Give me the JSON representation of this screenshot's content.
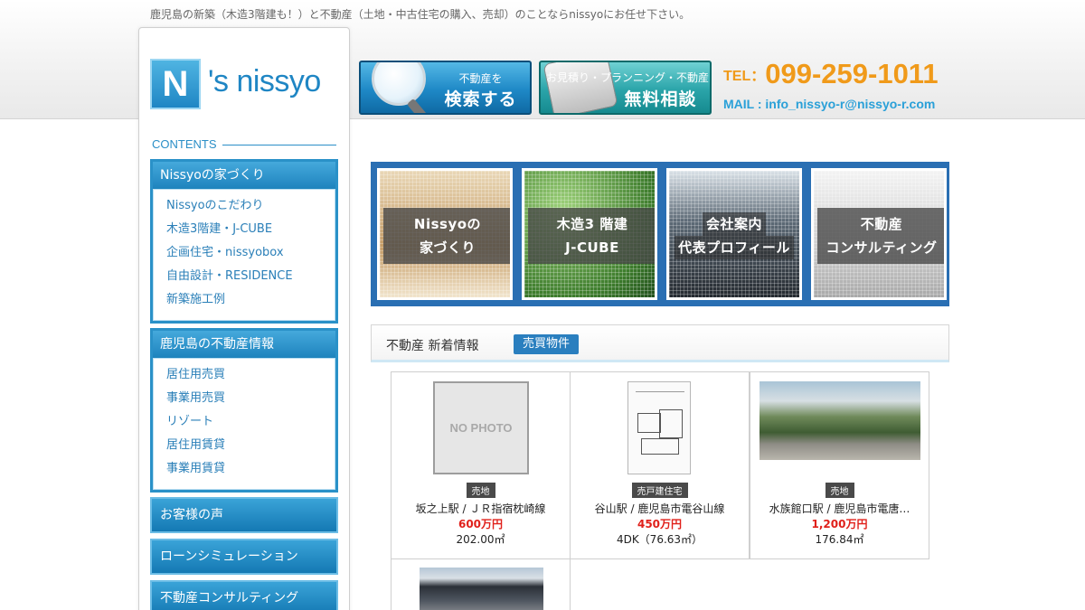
{
  "header": {
    "tagline": "鹿児島の新築（木造3階建も！）と不動産（土地・中古住宅の購入、売却）のことならnissyoにお任せ下さい。",
    "search_button": {
      "small": "不動産を",
      "big": "検索する"
    },
    "consult_button": {
      "small": "お見積り・プランニング・不動産の",
      "big": "無料相談"
    },
    "tel_label": "TEL：",
    "tel_number": "099-259-1011",
    "mail": "MAIL : info_nissyo-r@nissyo-r.com"
  },
  "logo": {
    "mark": "N",
    "text": "'s nissyo"
  },
  "sidebar": {
    "contents_heading": "CONTENTS",
    "sections": [
      {
        "title": "Nissyoの家づくり",
        "items": [
          "Nissyoのこだわり",
          "木造3階建・J-CUBE",
          "企画住宅・nissyobox",
          "自由設計・RESIDENCE",
          "新築施工例"
        ]
      },
      {
        "title": "鹿児島の不動産情報",
        "items": [
          "居住用売買",
          "事業用売買",
          "リゾート",
          "居住用賃貸",
          "事業用賃貸"
        ]
      }
    ],
    "buttons": [
      "お客様の声",
      "ローンシミュレーション",
      "不動産コンサルティング"
    ]
  },
  "banners": [
    {
      "line1": "Nissyoの",
      "line2": "家づくり"
    },
    {
      "line1": "木造3 階建",
      "line2": "J-CUBE"
    },
    {
      "line1": "会社案内",
      "line2": "代表プロフィール"
    },
    {
      "line1": "不動産",
      "line2": "コンサルティング"
    }
  ],
  "news": {
    "title": "不動産 新着情報",
    "tab": "売買物件",
    "listings": [
      {
        "thumb_text": "NO PHOTO",
        "type": "売地",
        "location": "坂之上駅 / ＪＲ指宿枕崎線",
        "price": "600万円",
        "size": "202.00㎡"
      },
      {
        "thumb_text": "",
        "type": "売戸建住宅",
        "location": "谷山駅 / 鹿児島市電谷山線",
        "price": "450万円",
        "size": "4DK（76.63㎡）"
      },
      {
        "thumb_text": "",
        "type": "売地",
        "location": "水族館口駅 / 鹿児島市電唐…",
        "price": "1,200万円",
        "size": "176.84㎡"
      }
    ]
  },
  "colors": {
    "accent": "#2a91c8",
    "tel": "#f09a1a",
    "price": "#e0201a"
  }
}
